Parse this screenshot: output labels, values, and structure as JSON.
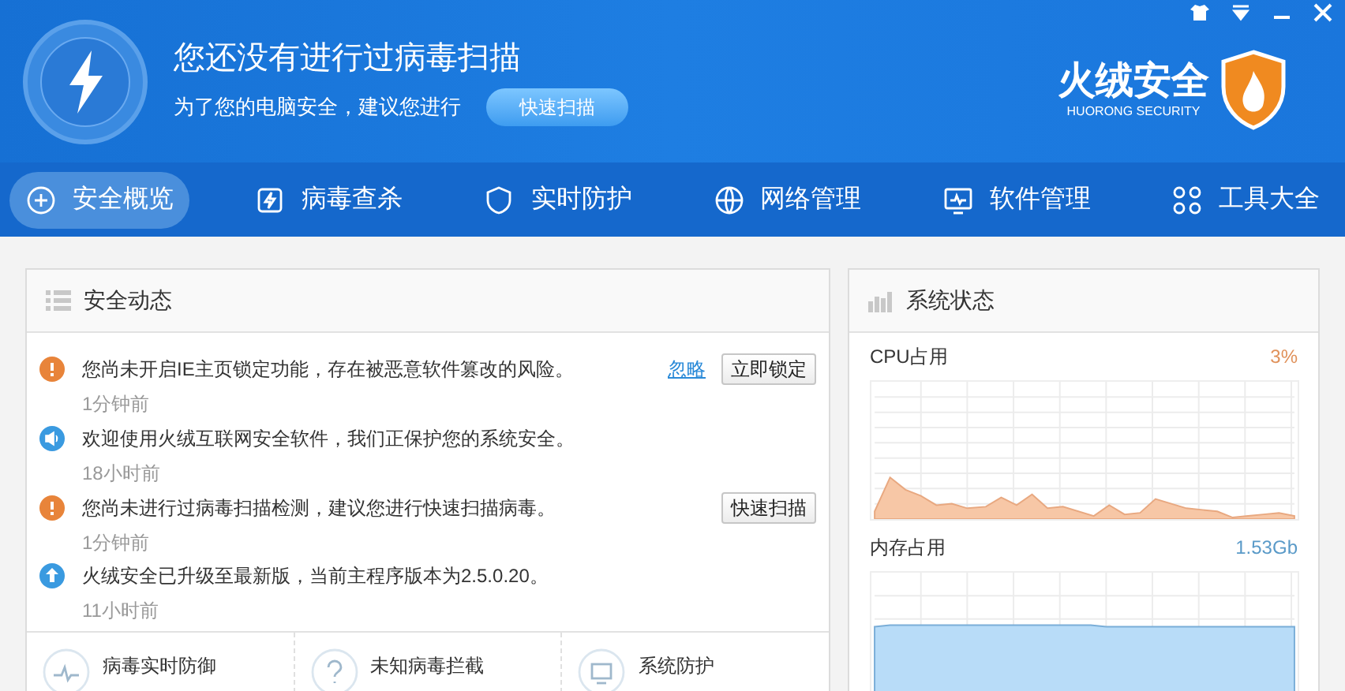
{
  "header": {
    "title": "您还没有进行过病毒扫描",
    "subtitle": "为了您的电脑安全，建议您进行",
    "scan_button": "快速扫描",
    "brand": "火绒安全",
    "brand_en": "HUORONG SECURITY"
  },
  "tabs": [
    {
      "label": "安全概览",
      "selected": true,
      "kind": "overview"
    },
    {
      "label": "病毒查杀",
      "selected": false,
      "kind": "scan"
    },
    {
      "label": "实时防护",
      "selected": false,
      "kind": "protect"
    },
    {
      "label": "网络管理",
      "selected": false,
      "kind": "network"
    },
    {
      "label": "软件管理",
      "selected": false,
      "kind": "software"
    },
    {
      "label": "工具大全",
      "selected": false,
      "kind": "tools"
    }
  ],
  "events": {
    "title": "安全动态",
    "items": [
      {
        "kind": "warning",
        "text": "您尚未开启IE主页锁定功能，存在被恶意软件篡改的风险。",
        "time": "1分钟前",
        "link": "忽略",
        "action": "立即锁定"
      },
      {
        "kind": "info",
        "text": "欢迎使用火绒互联网安全软件，我们正保护您的系统安全。",
        "time": "18小时前"
      },
      {
        "kind": "warning",
        "text": "您尚未进行过病毒扫描检测，建议您进行快速扫描病毒。",
        "time": "1分钟前",
        "action": "快速扫描"
      },
      {
        "kind": "update",
        "text": "火绒安全已升级至最新版，当前主程序版本为2.5.0.20。",
        "time": "11小时前"
      }
    ]
  },
  "stats": [
    {
      "kind": "pulse",
      "label": "病毒实时防御"
    },
    {
      "kind": "question",
      "label": "未知病毒拦截"
    },
    {
      "kind": "screen",
      "label": "系统防护"
    }
  ],
  "status": {
    "title": "系统状态",
    "cpu_label": "CPU占用",
    "cpu_value": "3%",
    "mem_label": "内存占用",
    "mem_value": "1.53Gb"
  }
}
